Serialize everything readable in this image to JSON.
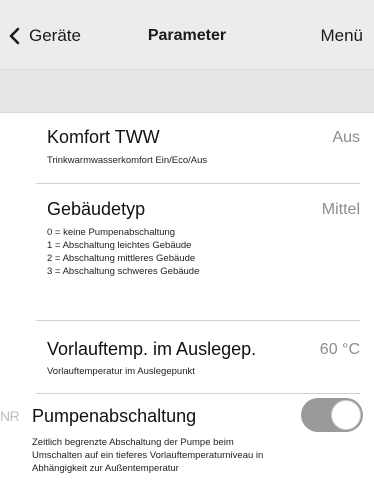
{
  "header": {
    "back_label": "Geräte",
    "title": "Parameter",
    "menu_label": "Menü"
  },
  "parameters": [
    {
      "title": "Komfort TWW",
      "value": "Aus",
      "description": "Trinkwarmwasserkomfort Ein/Eco/Aus"
    },
    {
      "title": "Gebäudetyp",
      "value": "Mittel",
      "description": "0 = keine Pumpenabschaltung\n1 = Abschaltung leichtes Gebäude\n2 = Abschaltung mittleres Gebäude\n3 = Abschaltung schweres Gebäude"
    },
    {
      "title": "Vorlauftemp. im Auslegep.",
      "value": "60 °C",
      "description": "Vorlauftemperatur im Auslegepunkt"
    },
    {
      "prefix": "NR",
      "title": "Pumpenabschaltung",
      "toggle_on": true,
      "description": "Zeitlich begrenzte Abschaltung der Pumpe beim\nUmschalten auf ein tieferes Vorlauftemperaturniveau in\nAbhängigkeit zur Außentemperatur"
    }
  ],
  "colors": {
    "header_bg": "#ececec",
    "subbar_bg": "#e6e6e6",
    "value_text": "#8c8c8c",
    "toggle_track": "#9a9a9a",
    "toggle_knob": "#ffffff"
  },
  "icons": {
    "back": "chevron-left-icon"
  }
}
